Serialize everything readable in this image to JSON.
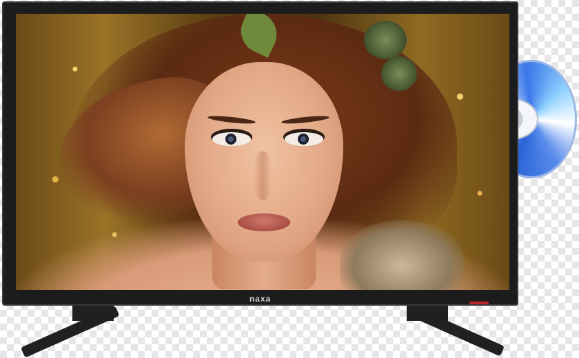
{
  "product": {
    "brand_logo_text": "naxa",
    "disc_type_icon": "dvd-disc-icon"
  },
  "colors": {
    "bezel": "#1c1c1c",
    "power_led": "#c0262a",
    "disc_accent": "#2a63d6"
  }
}
